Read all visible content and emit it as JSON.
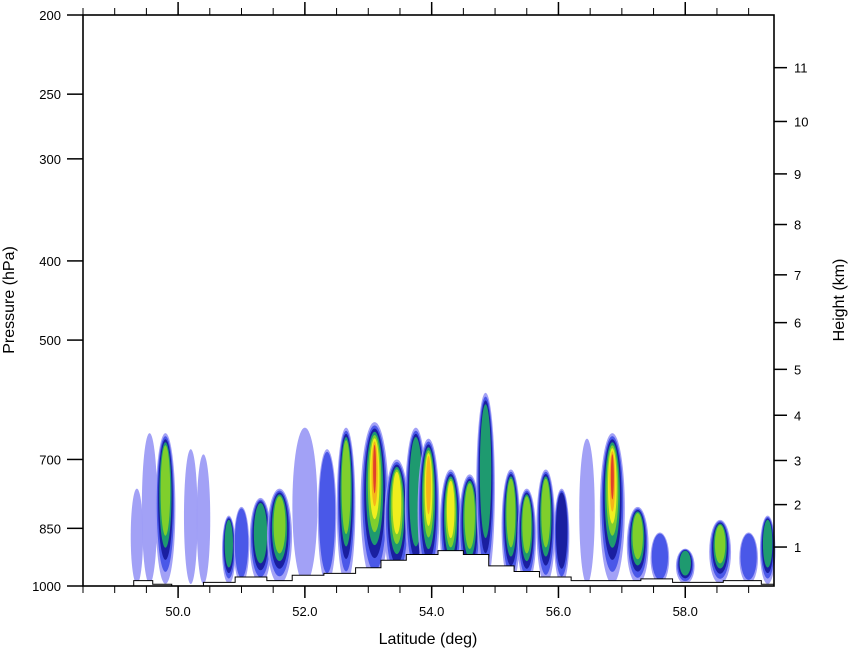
{
  "chart_data": {
    "type": "heatmap",
    "subtype": "latitude-pressure cross section (filled contours)",
    "xlabel": "Latitude (deg)",
    "ylabel": "Pressure (hPa)",
    "y2label": "Height (km)",
    "xlim": [
      48.5,
      59.4
    ],
    "ylim": [
      1000,
      200
    ],
    "yscale": "log",
    "y_reversed": true,
    "x_ticks": [
      50.0,
      52.0,
      54.0,
      56.0,
      58.0
    ],
    "x_tick_labels": [
      "50.0",
      "52.0",
      "54.0",
      "56.0",
      "58.0"
    ],
    "x_minor_step": 0.5,
    "y_ticks": [
      200,
      250,
      300,
      400,
      500,
      700,
      850,
      1000
    ],
    "y_tick_labels": [
      "200",
      "250",
      "300",
      "400",
      "500",
      "700",
      "850",
      "1000"
    ],
    "y2_ticks_km": [
      1,
      2,
      3,
      4,
      5,
      6,
      7,
      8,
      9,
      10,
      11
    ],
    "y2_tick_labels": [
      "1",
      "2",
      "3",
      "4",
      "5",
      "6",
      "7",
      "8",
      "9",
      "10",
      "11"
    ],
    "y2_tick_pressure_hPa": [
      896,
      795,
      702,
      618,
      543,
      476,
      416,
      361,
      313,
      270,
      232
    ],
    "grid": false,
    "legend": "none",
    "contour_colors": [
      "#9d9cf5",
      "#4a58e8",
      "#1a1fa0",
      "#1e9a6f",
      "#7fcf2c",
      "#f0ee1e",
      "#f5b41a",
      "#e1412a"
    ],
    "cells": [
      {
        "lat": 49.35,
        "top": 760,
        "w": 0.1,
        "level": 0
      },
      {
        "lat": 49.55,
        "top": 650,
        "w": 0.15,
        "level": 0
      },
      {
        "lat": 49.8,
        "top": 650,
        "w": 0.22,
        "level": 4
      },
      {
        "lat": 50.2,
        "top": 680,
        "w": 0.12,
        "level": 0
      },
      {
        "lat": 50.4,
        "top": 690,
        "w": 0.12,
        "level": 0
      },
      {
        "lat": 50.8,
        "top": 820,
        "w": 0.12,
        "level": 3
      },
      {
        "lat": 51.0,
        "top": 800,
        "w": 0.15,
        "level": 1
      },
      {
        "lat": 51.3,
        "top": 780,
        "w": 0.25,
        "level": 3
      },
      {
        "lat": 51.6,
        "top": 760,
        "w": 0.3,
        "level": 4
      },
      {
        "lat": 52.0,
        "top": 640,
        "w": 0.3,
        "level": 0
      },
      {
        "lat": 52.35,
        "top": 680,
        "w": 0.2,
        "level": 1
      },
      {
        "lat": 52.65,
        "top": 640,
        "w": 0.2,
        "level": 4
      },
      {
        "lat": 53.1,
        "top": 630,
        "w": 0.35,
        "level": 7
      },
      {
        "lat": 53.45,
        "top": 700,
        "w": 0.3,
        "level": 5
      },
      {
        "lat": 53.75,
        "top": 640,
        "w": 0.25,
        "level": 3
      },
      {
        "lat": 53.95,
        "top": 660,
        "w": 0.25,
        "level": 6
      },
      {
        "lat": 54.3,
        "top": 720,
        "w": 0.25,
        "level": 5
      },
      {
        "lat": 54.6,
        "top": 730,
        "w": 0.25,
        "level": 4
      },
      {
        "lat": 54.85,
        "top": 580,
        "w": 0.2,
        "level": 3
      },
      {
        "lat": 55.25,
        "top": 720,
        "w": 0.2,
        "level": 4
      },
      {
        "lat": 55.5,
        "top": 760,
        "w": 0.2,
        "level": 4
      },
      {
        "lat": 55.8,
        "top": 720,
        "w": 0.2,
        "level": 4
      },
      {
        "lat": 56.05,
        "top": 760,
        "w": 0.15,
        "level": 2
      },
      {
        "lat": 56.45,
        "top": 660,
        "w": 0.15,
        "level": 0
      },
      {
        "lat": 56.85,
        "top": 650,
        "w": 0.3,
        "level": 7
      },
      {
        "lat": 57.25,
        "top": 800,
        "w": 0.25,
        "level": 4
      },
      {
        "lat": 57.6,
        "top": 860,
        "w": 0.2,
        "level": 1
      },
      {
        "lat": 58.0,
        "top": 900,
        "w": 0.2,
        "level": 3
      },
      {
        "lat": 58.55,
        "top": 830,
        "w": 0.25,
        "level": 4
      },
      {
        "lat": 59.0,
        "top": 860,
        "w": 0.2,
        "level": 1
      },
      {
        "lat": 59.3,
        "top": 820,
        "w": 0.15,
        "level": 3
      }
    ],
    "terrain_surface_hPa": [
      [
        48.5,
        1000
      ],
      [
        49.3,
        1000
      ],
      [
        49.3,
        985
      ],
      [
        49.6,
        985
      ],
      [
        49.6,
        995
      ],
      [
        49.9,
        995
      ],
      [
        49.9,
        1000
      ],
      [
        50.4,
        1000
      ],
      [
        50.4,
        990
      ],
      [
        50.9,
        990
      ],
      [
        50.9,
        975
      ],
      [
        51.4,
        975
      ],
      [
        51.4,
        985
      ],
      [
        51.8,
        985
      ],
      [
        51.8,
        970
      ],
      [
        52.3,
        970
      ],
      [
        52.3,
        965
      ],
      [
        52.8,
        965
      ],
      [
        52.8,
        950
      ],
      [
        53.2,
        950
      ],
      [
        53.2,
        930
      ],
      [
        53.6,
        930
      ],
      [
        53.6,
        915
      ],
      [
        54.1,
        915
      ],
      [
        54.1,
        905
      ],
      [
        54.5,
        905
      ],
      [
        54.5,
        915
      ],
      [
        54.9,
        915
      ],
      [
        54.9,
        945
      ],
      [
        55.3,
        945
      ],
      [
        55.3,
        960
      ],
      [
        55.7,
        960
      ],
      [
        55.7,
        975
      ],
      [
        56.2,
        975
      ],
      [
        56.2,
        985
      ],
      [
        57.3,
        985
      ],
      [
        57.3,
        980
      ],
      [
        57.8,
        980
      ],
      [
        57.8,
        990
      ],
      [
        58.6,
        990
      ],
      [
        58.6,
        985
      ],
      [
        59.2,
        985
      ],
      [
        59.2,
        995
      ],
      [
        59.4,
        995
      ]
    ]
  }
}
